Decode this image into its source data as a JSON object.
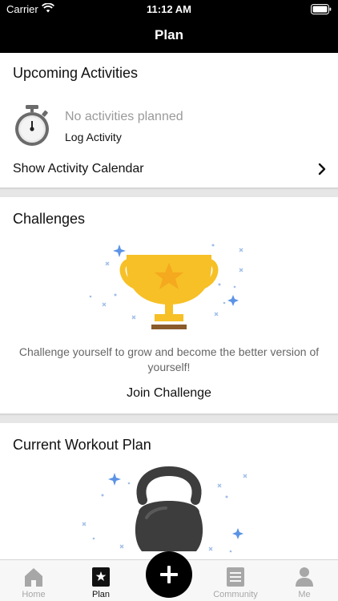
{
  "status_bar": {
    "carrier": "Carrier",
    "time": "11:12 AM"
  },
  "nav": {
    "title": "Plan"
  },
  "upcoming": {
    "title": "Upcoming Activities",
    "empty_text": "No activities planned",
    "log_activity_label": "Log Activity",
    "calendar_link": "Show Activity Calendar"
  },
  "challenges": {
    "title": "Challenges",
    "description": "Challenge yourself to grow and become the better version of yourself!",
    "join_label": "Join Challenge"
  },
  "workout_plan": {
    "title": "Current Workout Plan"
  },
  "tab_bar": {
    "tabs": [
      {
        "label": "Home",
        "icon": "home-icon",
        "active": false
      },
      {
        "label": "Plan",
        "icon": "plan-icon",
        "active": true
      },
      {
        "label": "Community",
        "icon": "community-icon",
        "active": false
      },
      {
        "label": "Me",
        "icon": "profile-icon",
        "active": false
      }
    ],
    "add_button_icon": "plus-icon"
  },
  "colors": {
    "nav_background": "#000000",
    "trophy_gold": "#f6c026",
    "trophy_star": "#f4a91f",
    "trophy_base": "#8a5a2b",
    "kettlebell": "#3d3d3d",
    "sparkle_blue": "#5b93e6",
    "tab_active": "#111111",
    "tab_inactive": "#a7a7a7"
  }
}
